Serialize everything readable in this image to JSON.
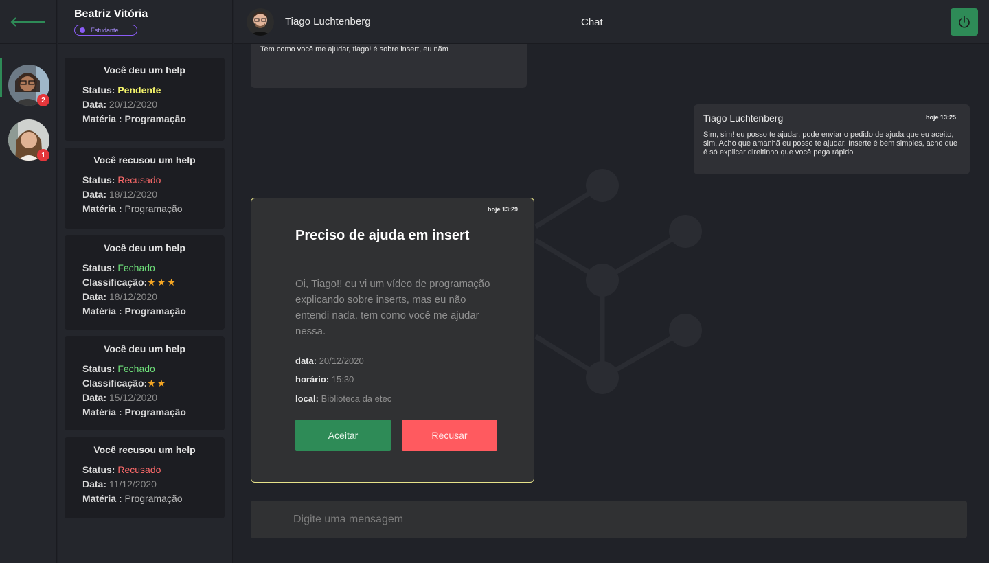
{
  "user": {
    "name": "Beatriz Vitória",
    "role": "Estudante"
  },
  "contacts": [
    {
      "badge": "2",
      "active": true
    },
    {
      "badge": "1",
      "active": false
    }
  ],
  "history": [
    {
      "title": "Você deu um help",
      "status_label": "Status:",
      "status": "Pendente",
      "date_label": "Data:",
      "date": "20/12/2020",
      "subject_label": "Matéria :",
      "subject": "Programação"
    },
    {
      "title": "Você recusou um help",
      "status_label": "Status:",
      "status": "Recusado",
      "date_label": "Data:",
      "date": "18/12/2020",
      "subject_label": "Matéria :",
      "subject": "Programação"
    },
    {
      "title": "Você deu um help",
      "status_label": "Status:",
      "status": "Fechado",
      "rating_label": "Classificação:",
      "rating": 3,
      "date_label": "Data:",
      "date": "18/12/2020",
      "subject_label": "Matéria :",
      "subject": "Programação"
    },
    {
      "title": "Você deu um help",
      "status_label": "Status:",
      "status": "Fechado",
      "rating_label": "Classificação:",
      "rating": 2,
      "date_label": "Data:",
      "date": "15/12/2020",
      "subject_label": "Matéria :",
      "subject": "Programação"
    },
    {
      "title": "Você recusou um help",
      "status_label": "Status:",
      "status": "Recusado",
      "date_label": "Data:",
      "date": "11/12/2020",
      "subject_label": "Matéria :",
      "subject": "Programação"
    }
  ],
  "chat": {
    "peer_name": "Tiago Luchtenberg",
    "title": "Chat",
    "prev_message": "Tem como você me ajudar, tiago! é sobre insert, eu nãm",
    "peer_message": {
      "author": "Tiago Luchtenberg",
      "time": "hoje 13:25",
      "text": "Sim,  sim! eu posso te ajudar. pode enviar o pedido de ajuda que eu aceito, sim. Acho que amanhã eu posso te ajudar. Inserte é bem simples, acho que é só explicar direitinho que você pega  rápido"
    },
    "request": {
      "time": "hoje 13:29",
      "title": "Preciso de ajuda em insert",
      "body": "Oi, Tiago!! eu vi um vídeo de programação explicando sobre inserts, mas eu não entendi nada. tem como você me ajudar nessa.",
      "date_label": "data:",
      "date": "20/12/2020",
      "time_label": "horário:",
      "hour": "15:30",
      "place_label": "local:",
      "place": "Biblioteca da etec",
      "accept_label": "Aceitar",
      "refuse_label": "Recusar"
    },
    "composer": {
      "placeholder": "Digite uma mensagem"
    }
  },
  "colors": {
    "accent_green": "#2e8b57",
    "refuse_red": "#ff5a5f",
    "pending_yellow": "#f2f26b",
    "badge_red": "#e5363b",
    "role_purple": "#8b5cf6"
  },
  "icons": {
    "back": "arrow-left-icon",
    "power": "power-icon"
  }
}
